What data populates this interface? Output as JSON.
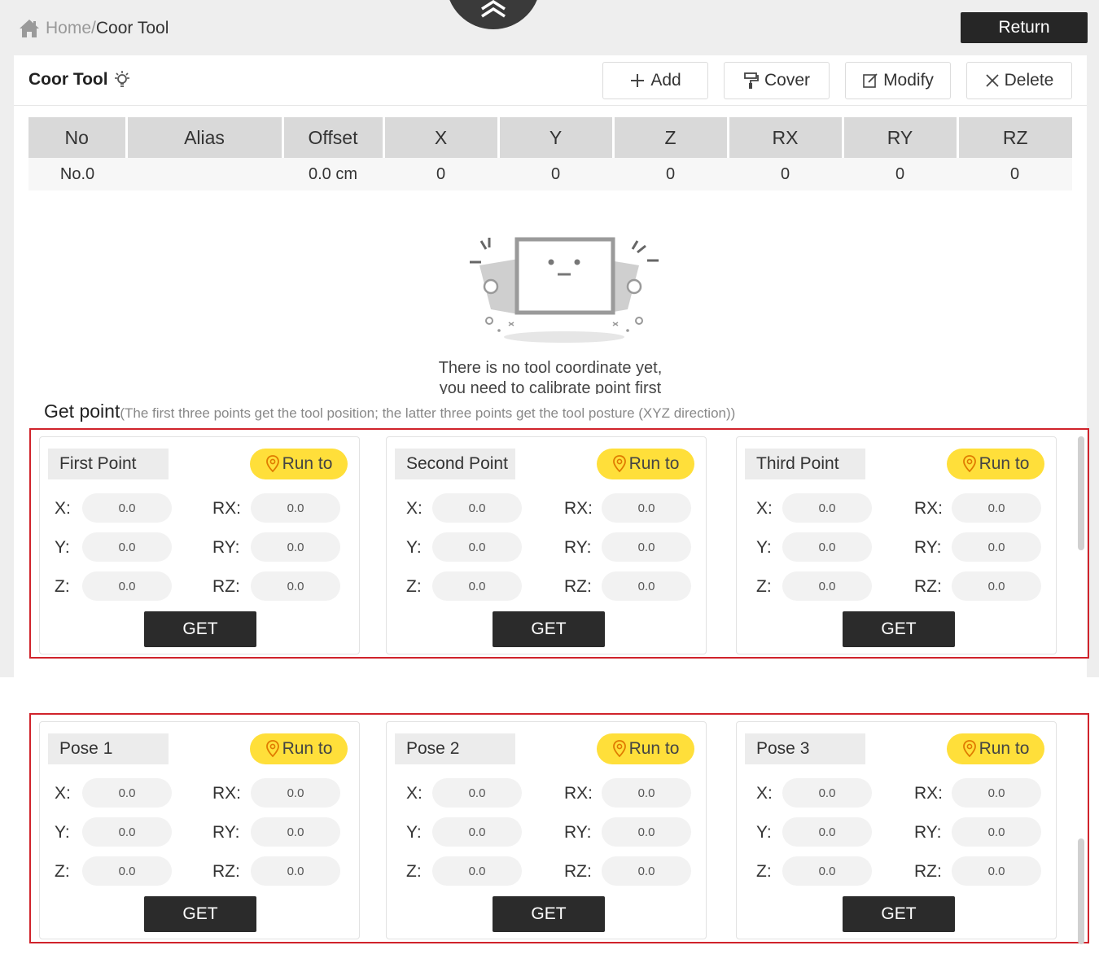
{
  "breadcrumb": {
    "home": "Home",
    "separator": "/",
    "current": "Coor Tool"
  },
  "header": {
    "return_label": "Return"
  },
  "panel": {
    "title": "Coor Tool",
    "toolbar": {
      "add": "Add",
      "cover": "Cover",
      "modify": "Modify",
      "delete": "Delete"
    }
  },
  "table": {
    "columns": [
      "No",
      "Alias",
      "Offset",
      "X",
      "Y",
      "Z",
      "RX",
      "RY",
      "RZ"
    ],
    "rows": [
      [
        "No.0",
        "",
        "0.0 cm",
        "0",
        "0",
        "0",
        "0",
        "0",
        "0"
      ]
    ]
  },
  "empty_state": {
    "line1": "There is no tool coordinate yet,",
    "line2": "you need to calibrate point first"
  },
  "get_point": {
    "title": "Get point",
    "hint": "(The first three points get the tool position; the latter three points get the tool posture (XYZ direction))"
  },
  "labels": {
    "x": "X:",
    "y": "Y:",
    "z": "Z:",
    "rx": "RX:",
    "ry": "RY:",
    "rz": "RZ:",
    "run_to": "Run to",
    "get": "GET"
  },
  "points": [
    {
      "title": "First Point",
      "x": "0.0",
      "y": "0.0",
      "z": "0.0",
      "rx": "0.0",
      "ry": "0.0",
      "rz": "0.0"
    },
    {
      "title": "Second Point",
      "x": "0.0",
      "y": "0.0",
      "z": "0.0",
      "rx": "0.0",
      "ry": "0.0",
      "rz": "0.0"
    },
    {
      "title": "Third Point",
      "x": "0.0",
      "y": "0.0",
      "z": "0.0",
      "rx": "0.0",
      "ry": "0.0",
      "rz": "0.0"
    }
  ],
  "poses": [
    {
      "title": "Pose 1",
      "x": "0.0",
      "y": "0.0",
      "z": "0.0",
      "rx": "0.0",
      "ry": "0.0",
      "rz": "0.0"
    },
    {
      "title": "Pose 2",
      "x": "0.0",
      "y": "0.0",
      "z": "0.0",
      "rx": "0.0",
      "ry": "0.0",
      "rz": "0.0"
    },
    {
      "title": "Pose 3",
      "x": "0.0",
      "y": "0.0",
      "z": "0.0",
      "rx": "0.0",
      "ry": "0.0",
      "rz": "0.0"
    }
  ],
  "colors": {
    "accent_yellow": "#ffdf3a",
    "highlight_red": "#d0232b",
    "dark_button": "#2b2b2b"
  },
  "icons": {
    "home": "home-icon",
    "collapse": "chevron-double-up-icon",
    "bulb": "lightbulb-icon",
    "add": "plus-icon",
    "cover": "paint-roller-icon",
    "modify": "edit-icon",
    "delete": "close-icon",
    "run_to": "location-pin-icon"
  }
}
